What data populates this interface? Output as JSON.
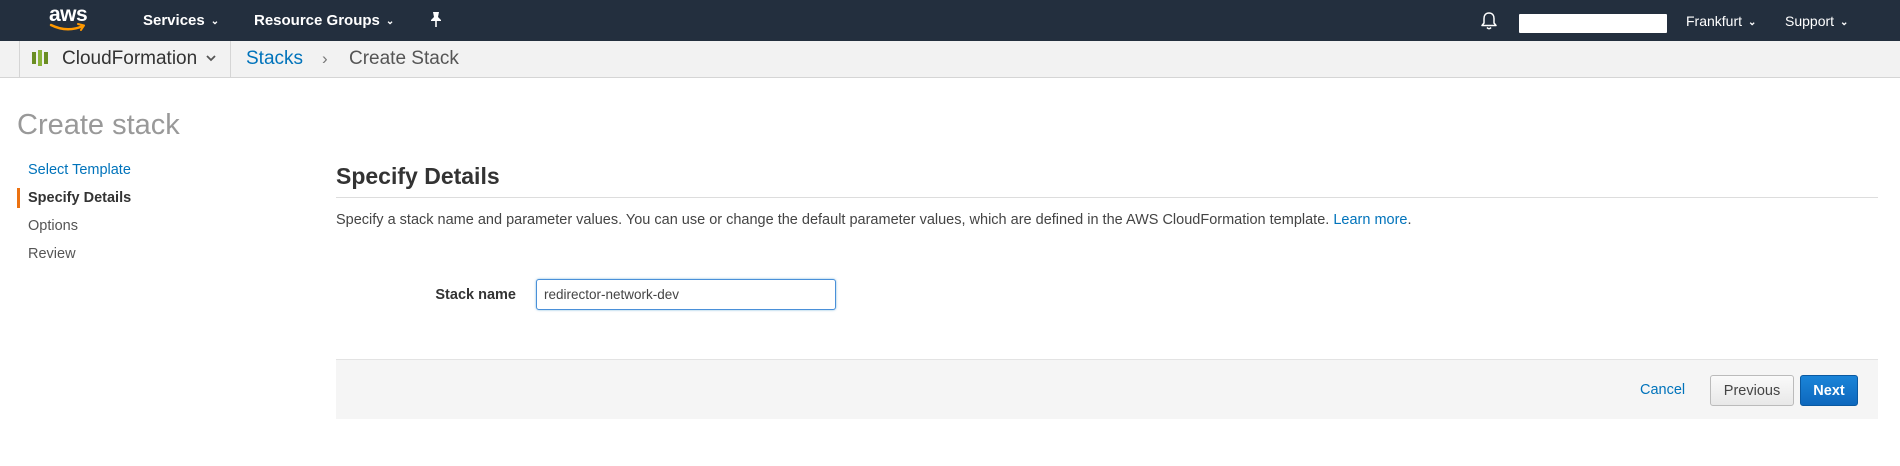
{
  "topnav": {
    "logo_text": "aws",
    "services_label": "Services",
    "resource_groups_label": "Resource Groups",
    "region_label": "Frankfurt",
    "support_label": "Support"
  },
  "breadcrumb": {
    "service_label": "CloudFormation",
    "stacks_link": "Stacks",
    "separator": "›",
    "current": "Create Stack"
  },
  "page": {
    "title": "Create stack"
  },
  "steps": [
    {
      "label": "Select Template"
    },
    {
      "label": "Specify Details"
    },
    {
      "label": "Options"
    },
    {
      "label": "Review"
    }
  ],
  "details": {
    "title": "Specify Details",
    "description": "Specify a stack name and parameter values. You can use or change the default parameter values, which are defined in the AWS CloudFormation template.",
    "learn_more": "Learn more",
    "period": ".",
    "stack_name_label": "Stack name",
    "stack_name_value": "redirector-network-dev"
  },
  "actions": {
    "cancel": "Cancel",
    "previous": "Previous",
    "next": "Next"
  },
  "colors": {
    "nav_bg": "#232f3e",
    "link": "#0073bb",
    "active_step": "#ec7211",
    "primary_button": "#0e68bd"
  }
}
